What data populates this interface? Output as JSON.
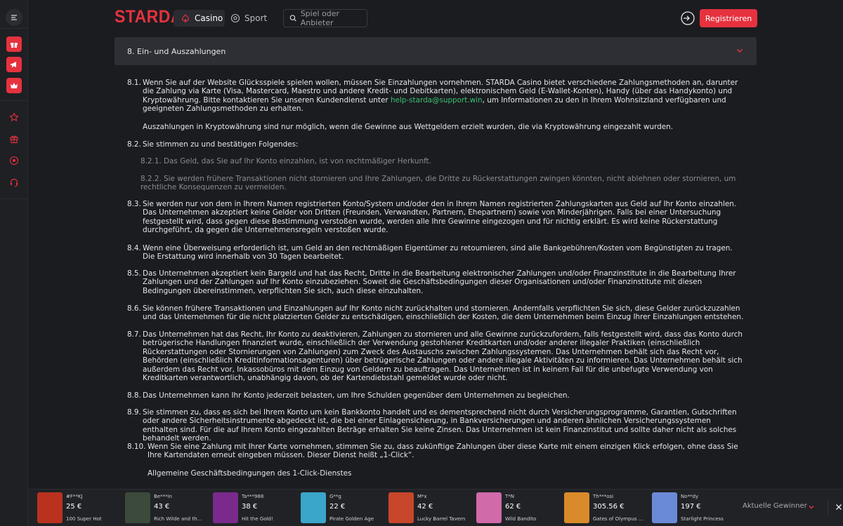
{
  "header": {
    "logo": "STARDA",
    "nav": [
      {
        "label": "Casino"
      },
      {
        "label": "Sport"
      }
    ],
    "search_placeholder": "Spiel oder Anbieter",
    "register_label": "Registrieren"
  },
  "section": {
    "title": "8. Ein- und Auszahlungen"
  },
  "terms": {
    "i81_num": "8.1.",
    "i81_a": "Wenn Sie auf der Website Glücksspiele spielen wollen, müssen Sie Einzahlungen vornehmen. STARDA Casino bietet verschiedene Zahlungsmethoden an, darunter die Zahlung via Karte (Visa, Mastercard, Maestro und andere Kredit- und Debitkarten), elektronischem Geld (E-Wallet-Konten), Handy (über das Handykonto) und Kryptowährung. Bitte kontaktieren Sie unseren Kundendienst unter ",
    "i81_link": "help-starda@support.win",
    "i81_b": ", um Informationen zu den in Ihrem Wohnsitzland verfügbaren und geeigneten Zahlungsmethoden zu erhalten.",
    "i81_p2": "Auszahlungen in Kryptowährung sind nur möglich, wenn die Gewinne aus Wettgeldern erzielt wurden, die via Kryptowährung eingezahlt wurden.",
    "i82_num": "8.2.",
    "i82": "Sie stimmen zu und bestätigen Folgendes:",
    "i821": "8.2.1. Das Geld, das Sie auf Ihr Konto einzahlen, ist von rechtmäßiger Herkunft.",
    "i822": "8.2.2. Sie werden frühere Transaktionen nicht stornieren und Ihre Zahlungen, die Dritte zu Rückerstattungen zwingen könnten, nicht ablehnen oder stornieren, um rechtliche Konsequenzen zu vermeiden.",
    "i83_num": "8.3.",
    "i83": "Sie werden nur von dem in Ihrem Namen registrierten Konto/System und/oder den in Ihrem Namen registrierten Zahlungskarten aus Geld auf Ihr Konto einzahlen. Das Unternehmen akzeptiert keine Gelder von Dritten (Freunden, Verwandten, Partnern, Ehepartnern) sowie von Minderjährigen. Falls bei einer Untersuchung festgestellt wird, dass gegen diese Bestimmung verstoßen wurde, werden alle Ihre Gewinne eingezogen und für nichtig erklärt. Es wird keine Rückerstattung durchgeführt, da gegen die Unternehmensregeln verstoßen wurde.",
    "i84_num": "8.4.",
    "i84": "Wenn eine Überweisung erforderlich ist, um Geld an den rechtmäßigen Eigentümer zu retournieren, sind alle Bankgebühren/Kosten vom Begünstigten zu tragen. Die Erstattung wird innerhalb von 30 Tagen bearbeitet.",
    "i85_num": "8.5.",
    "i85": "Das Unternehmen akzeptiert kein Bargeld und hat das Recht, Dritte in die Bearbeitung elektronischer Zahlungen und/oder Finanzinstitute in die Bearbeitung Ihrer Zahlungen und der Zahlungen auf Ihr Konto einzubeziehen. Soweit die Geschäftsbedingungen dieser Organisationen und/oder Finanzinstitute mit diesen Bedingungen übereinstimmen, verpflichten Sie sich, auch diese einzuhalten.",
    "i86_num": "8.6.",
    "i86": "Sie können frühere Transaktionen und Einzahlungen auf Ihr Konto nicht zurückhalten und stornieren. Andernfalls verpflichten Sie sich, diese Gelder zurückzuzahlen und das Unternehmen für die nicht platzierten Gelder zu entschädigen, einschließlich der Kosten, die dem Unternehmen beim Einzug Ihrer Einzahlungen entstehen.",
    "i87_num": "8.7.",
    "i87": "Das Unternehmen hat das Recht, Ihr Konto zu deaktivieren, Zahlungen zu stornieren und alle Gewinne zurückzufordern, falls festgestellt wird, dass das Konto durch betrügerische Handlungen finanziert wurde, einschließlich der Verwendung gestohlener Kreditkarten und/oder anderer illegaler Praktiken (einschließlich Rückerstattungen oder Stornierungen von Zahlungen) zum Zweck des Austauschs zwischen Zahlungssystemen. Das Unternehmen behält sich das Recht vor, Behörden (einschließlich Kreditinformationsagenturen) über betrügerische Zahlungen oder andere illegale Aktivitäten zu informieren. Das Unternehmen behält sich außerdem das Recht vor, Inkassobüros mit dem Einzug von Geldern zu beauftragen. Das Unternehmen ist in keinem Fall für die unbefugte Verwendung von Kreditkarten verantwortlich, unabhängig davon, ob der Kartendiebstahl gemeldet wurde oder nicht.",
    "i88_num": "8.8.",
    "i88": "Das Unternehmen kann Ihr Konto jederzeit belasten, um Ihre Schulden gegenüber dem Unternehmen zu begleichen.",
    "i89_num": "8.9.",
    "i89": "Sie stimmen zu, dass es sich bei Ihrem Konto um kein Bankkonto handelt und es dementsprechend nicht durch Versicherungsprogramme, Garantien, Gutschriften oder andere Sicherheitsinstrumente abgedeckt ist, die bei einer Einlagensicherung, in Bankversicherungen und anderen ähnlichen Versicherungssystemen enthalten sind. Für die auf Ihrem Konto eingezahlten Beträge erhalten Sie keine Zinsen. Das Unternehmen ist kein Finanzinstitut und sollte daher nicht als solches behandelt werden.",
    "i810_num": "8.10.",
    "i810": "Wenn Sie eine Zahlung mit Ihrer Karte vornehmen, stimmen Sie zu, dass zukünftige Zahlungen über diese Karte mit einem einzigen Klick erfolgen, ohne dass Sie Ihre Kartendaten erneut eingeben müssen. Dieser Dienst heißt „1-Click“.",
    "i810_p2": "Allgemeine Geschäftsbedingungen des 1-Click-Dienstes"
  },
  "winners": [
    {
      "name": "#F**KJ",
      "amount": "25 €",
      "game": "100 Super Hot",
      "color": "#b8321f"
    },
    {
      "name": "Be***in",
      "amount": "43 €",
      "game": "Rich Wilde and th...",
      "color": "#3b4a3a"
    },
    {
      "name": "Ta***988",
      "amount": "38 €",
      "game": "Hit the Gold!",
      "color": "#7a2a8c"
    },
    {
      "name": "G**g",
      "amount": "22 €",
      "game": "Pirate Golden Age",
      "color": "#3aa6c9"
    },
    {
      "name": "M*x",
      "amount": "42 €",
      "game": "Lucky Barrel Tavern",
      "color": "#c8462a"
    },
    {
      "name": "T*N",
      "amount": "62 €",
      "game": "Wild Bandito",
      "color": "#d06aa8"
    },
    {
      "name": "Th***osi",
      "amount": "305.56 €",
      "game": "Gates of Olympus ...",
      "color": "#d98a2a"
    },
    {
      "name": "No**dy",
      "amount": "197 €",
      "game": "Starlight Princess",
      "color": "#6a8ad8"
    }
  ],
  "recent_winners_label": "Aktuelle Gewinner",
  "colors": {
    "accent": "#e5323e",
    "link": "#38c172"
  }
}
